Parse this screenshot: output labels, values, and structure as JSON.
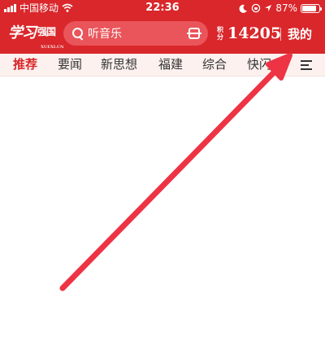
{
  "status_bar": {
    "carrier": "中国移动",
    "time": "22:36",
    "battery": "87%",
    "battery_level": 0.87
  },
  "header": {
    "logo_text": "学习",
    "logo_sub": "强国",
    "logo_tiny": "XUEXI.CN",
    "search_placeholder": "听音乐",
    "points_label": "积分",
    "points_value": "14205",
    "mine_label": "我的"
  },
  "tabs": [
    {
      "label": "推荐",
      "active": true
    },
    {
      "label": "要闻"
    },
    {
      "label": "新思想"
    },
    {
      "label": "福建"
    },
    {
      "label": "综合"
    },
    {
      "label": "快闪"
    }
  ],
  "colors": {
    "brand_red": "#d9272b",
    "tab_bg": "#fcf1ef",
    "arrow_red": "#ee3344"
  },
  "icons": {
    "search": "search-icon",
    "scan": "scan-icon",
    "menu": "menu-icon",
    "wifi": "wifi-icon",
    "moon": "moon-icon",
    "lock": "rotation-lock-icon",
    "location": "location-icon"
  }
}
